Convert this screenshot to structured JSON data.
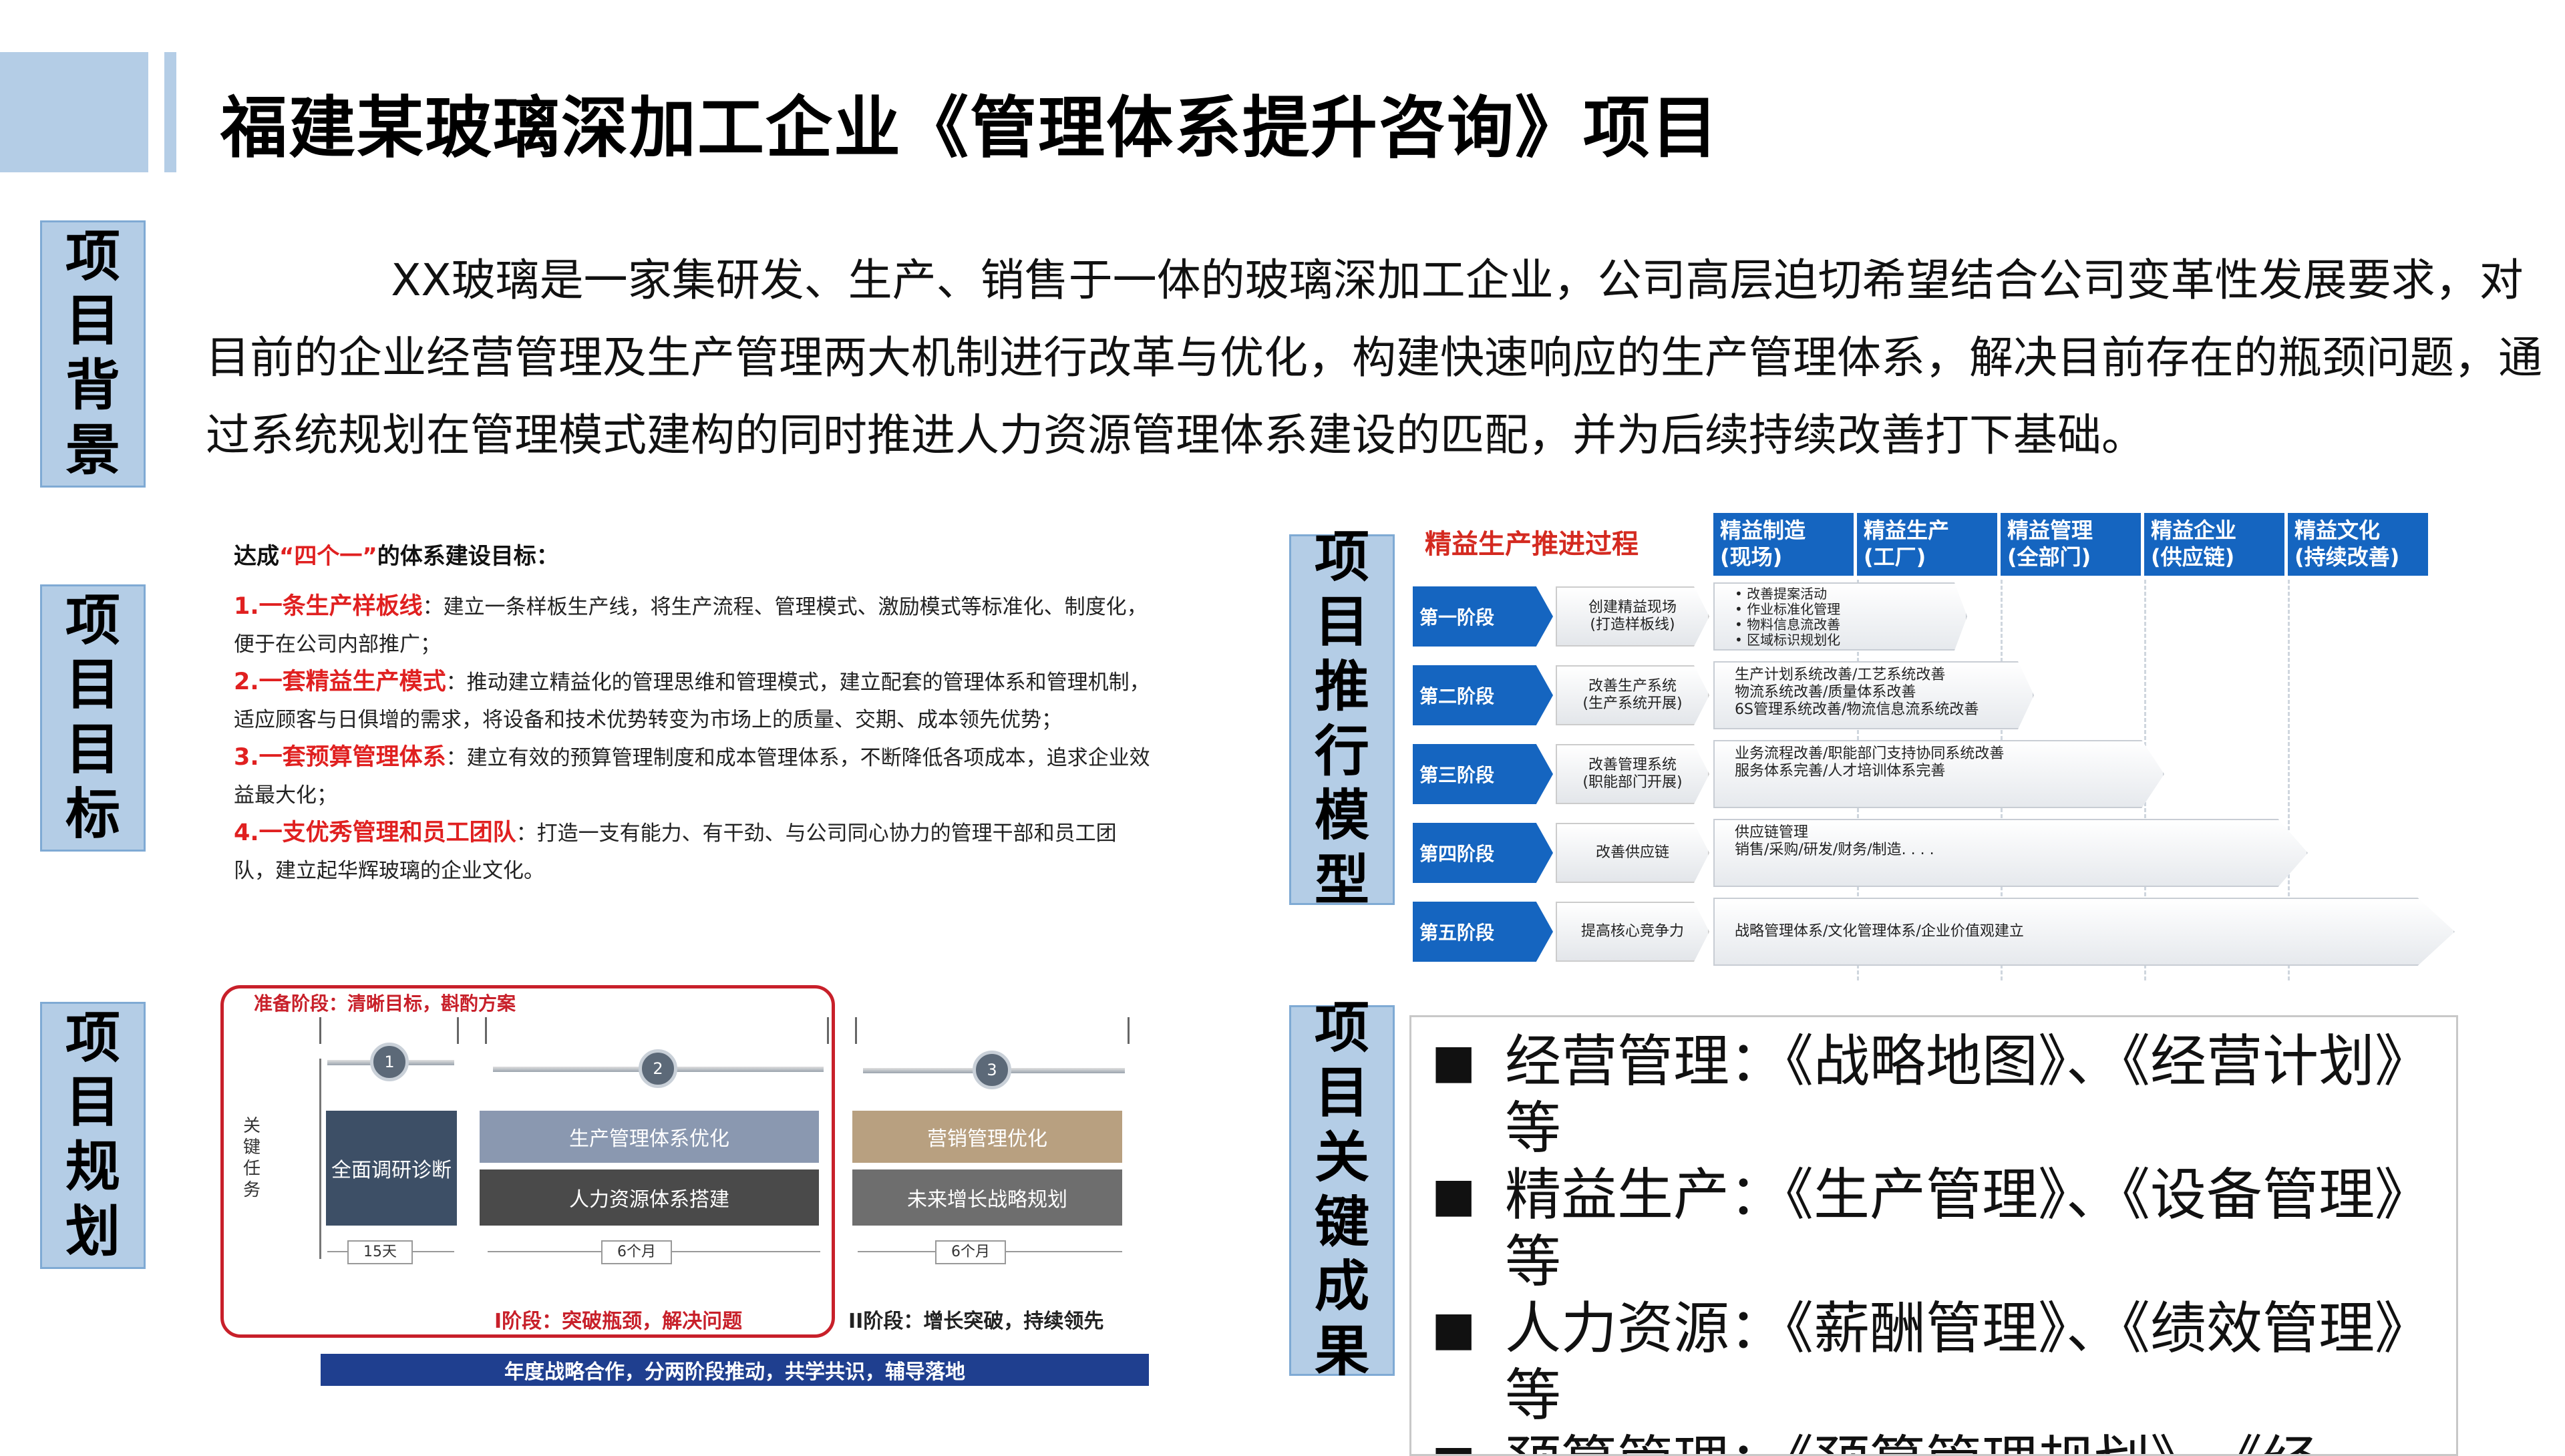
{
  "title": "福建某玻璃深加工企业《管理体系提升咨询》项目",
  "labels": {
    "background": "项目背景",
    "goal": "项目目标",
    "plan": "项目规划",
    "model": "项目推行模型",
    "results": "项目关键成果"
  },
  "background_text": "XX玻璃是一家集研发、生产、销售于一体的玻璃深加工企业，公司高层迫切希望结合公司变革性发展要求，对目前的企业经营管理及生产管理两大机制进行改革与优化，构建快速响应的生产管理体系，解决目前存在的瓶颈问题，通过系统规划在管理模式建构的同时推进人力资源管理体系建设的匹配，并为后续持续改善打下基础。",
  "goals": {
    "intro_prefix": "达成",
    "intro_highlight": "“四个一”",
    "intro_suffix": "的体系建设目标：",
    "items": [
      {
        "head": "1.一条生产样板线",
        "text": "：建立一条样板生产线，将生产流程、管理模式、激励模式等标准化、制度化，便于在公司内部推广；"
      },
      {
        "head": "2.一套精益生产模式",
        "text": "：推动建立精益化的管理思维和管理模式，建立配套的管理体系和管理机制，适应顾客与日俱增的需求，将设备和技术优势转变为市场上的质量、交期、成本领先优势；"
      },
      {
        "head": "3.一套预算管理体系",
        "text": "：建立有效的预算管理制度和成本管理体系，不断降低各项成本，追求企业效益最大化；"
      },
      {
        "head": "4.一支优秀管理和员工团队",
        "text": "：打造一支有能力、有干劲、与公司同心协力的管理干部和员工团队，建立起华辉玻璃的企业文化。"
      }
    ]
  },
  "plan": {
    "prep_label": "准备阶段：清晰目标，斟酌方案",
    "key_tasks": "关键任务",
    "stages": [
      "1",
      "2",
      "3"
    ],
    "tasks": {
      "stage1": "全面调研诊断",
      "stage2_top": "生产管理体系优化",
      "stage2_bottom": "人力资源体系搭建",
      "stage3_top": "营销管理优化",
      "stage3_bottom": "未来增长战略规划"
    },
    "durations": [
      "15天",
      "6个月",
      "6个月"
    ],
    "phase1": "I阶段：突破瓶颈，解决问题",
    "phase2": "II阶段：增长突破，持续领先",
    "footer": "年度战略合作，分两阶段推动，共学共识，辅导落地",
    "colors": {
      "stage1": "#3d4f66",
      "stage2_top": "#8a98b0",
      "stage2_bottom": "#4a4a4a",
      "stage3_top": "#b8a080",
      "stage3_bottom": "#6e6e6e",
      "red": "#c8202a"
    }
  },
  "model": {
    "title": "精益生产推进过程",
    "columns": [
      "精益制造\n(现场)",
      "精益生产\n(工厂)",
      "精益管理\n(全部门)",
      "精益企业\n(供应链)",
      "精益文化\n(持续改善)"
    ],
    "phases": [
      {
        "name": "第一阶段",
        "desc": "创建精益现场\n(打造样板线)",
        "content": "• 改善提案活动\n• 作业标准化管理\n• 物料信息流改善\n• 区域标识规划化"
      },
      {
        "name": "第二阶段",
        "desc": "改善生产系统\n(生产系统开展)",
        "content": "生产计划系统改善/工艺系统改善\n物流系统改善/质量体系改善\n6S管理系统改善/物流信息流系统改善"
      },
      {
        "name": "第三阶段",
        "desc": "改善管理系统\n(职能部门开展)",
        "content": "业务流程改善/职能部门支持协同系统改善\n服务体系完善/人才培训体系完善"
      },
      {
        "name": "第四阶段",
        "desc": "改善供应链",
        "content": "供应链管理\n销售/采购/研发/财务/制造. . . ."
      },
      {
        "name": "第五阶段",
        "desc": "提高核心竞争力",
        "content": "战略管理体系/文化管理体系/企业价值观建立"
      }
    ]
  },
  "results": {
    "bullet": "■",
    "items": [
      "经营管理：《战略地图》、《经营计划》等",
      "精益生产：《生产管理》、《设备管理》等",
      "人力资源：《薪酬管理》、《绩效管理》等",
      "预算管理：《预算管理规划》、《经"
    ]
  }
}
